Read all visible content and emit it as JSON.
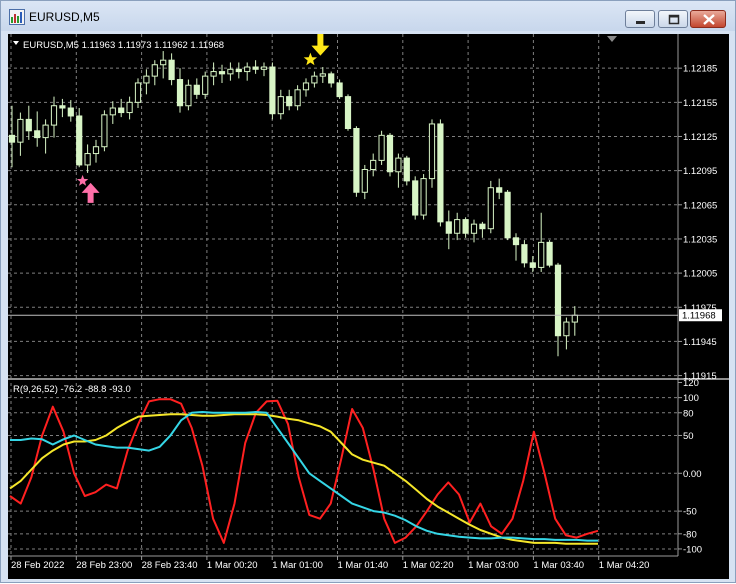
{
  "window": {
    "title": "EURUSD,M5",
    "buttons": [
      "minimize",
      "maximize",
      "close"
    ]
  },
  "colors": {
    "background": "#000000",
    "grid": "#7f7f7f",
    "bull_candle": "#d8f5c6",
    "bear_candle": "#d8f5c6",
    "price_line": "#c0c0c0",
    "red_line": "#ff2020",
    "yellow_line": "#f5e62a",
    "cyan_line": "#35d6e6",
    "buy_arrow": "#ff6fa8",
    "sell_arrow": "#ffe817"
  },
  "chart_data": [
    {
      "type": "candlestick",
      "header": "EURUSD,M5  1.11963 1.11973 1.11962 1.11968",
      "y_ticks": [
        "1.12185",
        "1.12155",
        "1.12125",
        "1.12095",
        "1.12065",
        "1.12035",
        "1.12005",
        "1.11975",
        "1.11945",
        "1.11915"
      ],
      "y_tick_values": [
        1.12185,
        1.12155,
        1.12125,
        1.12095,
        1.12065,
        1.12035,
        1.12005,
        1.11975,
        1.11945,
        1.11915
      ],
      "ylim": [
        1.11912,
        1.12215
      ],
      "current_price_label": "1.11968",
      "current_price": 1.11968,
      "x_labels": [
        "28 Feb 2022",
        "28 Feb 23:00",
        "28 Feb 23:40",
        "1 Mar 00:20",
        "1 Mar 01:00",
        "1 Mar 01:40",
        "1 Mar 02:20",
        "1 Mar 03:00",
        "1 Mar 03:40",
        "1 Mar 04:20"
      ],
      "candles": [
        [
          1.12126,
          1.12152,
          1.12098,
          1.1212
        ],
        [
          1.1212,
          1.12146,
          1.12108,
          1.1214
        ],
        [
          1.1214,
          1.12152,
          1.12122,
          1.1213
        ],
        [
          1.1213,
          1.12147,
          1.12116,
          1.12124
        ],
        [
          1.12124,
          1.1214,
          1.1211,
          1.12135
        ],
        [
          1.12135,
          1.1216,
          1.12124,
          1.12152
        ],
        [
          1.12152,
          1.12158,
          1.12142,
          1.1215
        ],
        [
          1.1215,
          1.12157,
          1.12138,
          1.12143
        ],
        [
          1.12143,
          1.1215,
          1.12098,
          1.121
        ],
        [
          1.121,
          1.12118,
          1.12093,
          1.1211
        ],
        [
          1.1211,
          1.12122,
          1.12102,
          1.12116
        ],
        [
          1.12116,
          1.12148,
          1.12112,
          1.12144
        ],
        [
          1.12144,
          1.12156,
          1.12136,
          1.1215
        ],
        [
          1.1215,
          1.12158,
          1.12142,
          1.12146
        ],
        [
          1.12146,
          1.1216,
          1.1214,
          1.12155
        ],
        [
          1.12155,
          1.12176,
          1.1215,
          1.12172
        ],
        [
          1.12172,
          1.12184,
          1.12162,
          1.12178
        ],
        [
          1.12178,
          1.12192,
          1.1217,
          1.12188
        ],
        [
          1.12188,
          1.122,
          1.12176,
          1.12192
        ],
        [
          1.12192,
          1.12198,
          1.1217,
          1.12175
        ],
        [
          1.12175,
          1.12185,
          1.12146,
          1.12152
        ],
        [
          1.12152,
          1.12175,
          1.12148,
          1.1217
        ],
        [
          1.1217,
          1.12176,
          1.12158,
          1.12162
        ],
        [
          1.12162,
          1.12182,
          1.12158,
          1.12178
        ],
        [
          1.12178,
          1.1219,
          1.1217,
          1.12182
        ],
        [
          1.12182,
          1.12188,
          1.12172,
          1.1218
        ],
        [
          1.1218,
          1.1219,
          1.12174,
          1.12184
        ],
        [
          1.12184,
          1.1219,
          1.12176,
          1.12182
        ],
        [
          1.12182,
          1.1219,
          1.12174,
          1.12186
        ],
        [
          1.12186,
          1.12192,
          1.1218,
          1.12184
        ],
        [
          1.12184,
          1.1219,
          1.12178,
          1.12186
        ],
        [
          1.12186,
          1.1219,
          1.1214,
          1.12145
        ],
        [
          1.12145,
          1.12166,
          1.1214,
          1.1216
        ],
        [
          1.1216,
          1.12166,
          1.12148,
          1.12152
        ],
        [
          1.12152,
          1.1217,
          1.12148,
          1.12166
        ],
        [
          1.12166,
          1.12176,
          1.1216,
          1.12172
        ],
        [
          1.12172,
          1.12182,
          1.12168,
          1.12178
        ],
        [
          1.12178,
          1.12186,
          1.12172,
          1.1218
        ],
        [
          1.1218,
          1.12182,
          1.12168,
          1.12172
        ],
        [
          1.12172,
          1.12175,
          1.12158,
          1.1216
        ],
        [
          1.1216,
          1.12162,
          1.1213,
          1.12132
        ],
        [
          1.12132,
          1.12134,
          1.12072,
          1.12076
        ],
        [
          1.12076,
          1.121,
          1.1207,
          1.12096
        ],
        [
          1.12096,
          1.1211,
          1.1209,
          1.12104
        ],
        [
          1.12104,
          1.1213,
          1.121,
          1.12126
        ],
        [
          1.12126,
          1.12128,
          1.1209,
          1.12094
        ],
        [
          1.12094,
          1.1211,
          1.1208,
          1.12106
        ],
        [
          1.12106,
          1.12108,
          1.12082,
          1.12086
        ],
        [
          1.12086,
          1.1209,
          1.12052,
          1.12056
        ],
        [
          1.12056,
          1.12092,
          1.12052,
          1.12088
        ],
        [
          1.12088,
          1.1214,
          1.1208,
          1.12136
        ],
        [
          1.12136,
          1.1214,
          1.12046,
          1.1205
        ],
        [
          1.1205,
          1.1206,
          1.12026,
          1.1204
        ],
        [
          1.1204,
          1.12058,
          1.12034,
          1.12052
        ],
        [
          1.12052,
          1.12054,
          1.12036,
          1.1204
        ],
        [
          1.1204,
          1.12052,
          1.12032,
          1.12048
        ],
        [
          1.12048,
          1.1205,
          1.12036,
          1.12044
        ],
        [
          1.12044,
          1.12086,
          1.1204,
          1.1208
        ],
        [
          1.1208,
          1.12088,
          1.1207,
          1.12076
        ],
        [
          1.12076,
          1.12078,
          1.12034,
          1.12036
        ],
        [
          1.12036,
          1.1204,
          1.12016,
          1.1203
        ],
        [
          1.1203,
          1.12034,
          1.1201,
          1.12014
        ],
        [
          1.12014,
          1.1202,
          1.12006,
          1.1201
        ],
        [
          1.1201,
          1.12058,
          1.12006,
          1.12032
        ],
        [
          1.12032,
          1.12034,
          1.1201,
          1.12012
        ],
        [
          1.12012,
          1.12014,
          1.11932,
          1.1195
        ],
        [
          1.1195,
          1.11966,
          1.11938,
          1.11962
        ],
        [
          1.11962,
          1.11976,
          1.1195,
          1.11968
        ]
      ],
      "signals": [
        {
          "type": "buy",
          "candle_index": 9
        },
        {
          "type": "sell",
          "candle_index": 36
        }
      ]
    },
    {
      "type": "line",
      "header": "R(9,26,52) -76.2 -88.8 -93.0",
      "y_ticks": [
        "120",
        "100",
        "80",
        "50",
        "0.00",
        "-50",
        "-80",
        "-100"
      ],
      "y_tick_values": [
        120,
        100,
        80,
        50,
        0,
        -50,
        -80,
        -100
      ],
      "ylim": [
        -108,
        122
      ],
      "series": [
        {
          "color": "#ff2020",
          "values": [
            -30,
            -40,
            -5,
            50,
            88,
            55,
            0,
            -30,
            -25,
            -15,
            -20,
            30,
            65,
            95,
            98,
            98,
            92,
            60,
            10,
            -60,
            -92,
            -40,
            40,
            80,
            95,
            96,
            65,
            -5,
            -55,
            -60,
            -40,
            20,
            85,
            60,
            5,
            -60,
            -92,
            -85,
            -70,
            -50,
            -28,
            -12,
            -28,
            -65,
            -40,
            -70,
            -80,
            -60,
            -10,
            55,
            0,
            -60,
            -82,
            -85,
            -80,
            -76
          ]
        },
        {
          "color": "#f5e62a",
          "values": [
            -20,
            -10,
            5,
            20,
            30,
            38,
            42,
            42,
            44,
            50,
            60,
            68,
            75,
            76,
            77,
            78,
            78,
            77,
            76,
            76,
            77,
            78,
            78,
            78,
            77,
            75,
            72,
            70,
            66,
            62,
            55,
            40,
            25,
            18,
            14,
            10,
            0,
            -10,
            -22,
            -34,
            -44,
            -52,
            -60,
            -68,
            -75,
            -80,
            -85,
            -88,
            -90,
            -92,
            -92,
            -92,
            -93,
            -93,
            -93,
            -93
          ]
        },
        {
          "color": "#35d6e6",
          "values": [
            44,
            44,
            46,
            45,
            38,
            45,
            50,
            44,
            38,
            36,
            34,
            34,
            32,
            30,
            35,
            50,
            70,
            80,
            81,
            80,
            80,
            80,
            80,
            81,
            80,
            60,
            40,
            20,
            0,
            -10,
            -20,
            -30,
            -40,
            -45,
            -50,
            -52,
            -56,
            -62,
            -70,
            -76,
            -80,
            -82,
            -84,
            -85,
            -86,
            -86,
            -85,
            -85,
            -86,
            -87,
            -87,
            -88,
            -88,
            -88,
            -89,
            -89
          ]
        }
      ]
    }
  ]
}
